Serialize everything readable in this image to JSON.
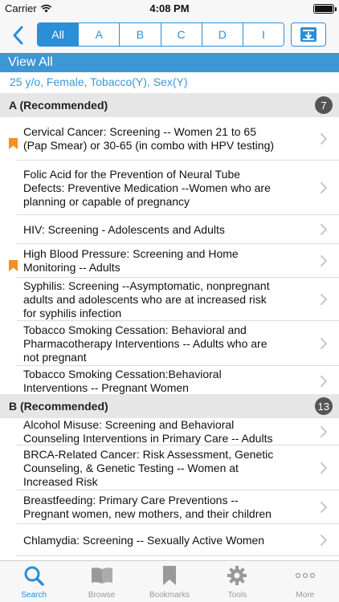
{
  "status_bar": {
    "carrier": "Carrier",
    "time": "4:08 PM"
  },
  "nav": {
    "segments": [
      "All",
      "A",
      "B",
      "C",
      "D",
      "I"
    ],
    "active_segment": "All"
  },
  "view": {
    "title": "View All",
    "criteria": "25 y/o, Female, Tobacco(Y), Sex(Y)"
  },
  "sections": [
    {
      "title": "A (Recommended)",
      "count": "7",
      "items": [
        {
          "lines": [
            "Cervical Cancer: Screening -- Women 21 to 65",
            "(Pap Smear) or 30-65 (in combo with HPV testing)"
          ],
          "bookmarked": true
        },
        {
          "lines": [
            "Folic Acid for the Prevention of Neural Tube",
            "Defects: Preventive Medication --Women who are",
            "planning or capable of pregnancy"
          ],
          "bookmarked": false
        },
        {
          "lines": [
            "HIV: Screening - Adolescents and Adults"
          ],
          "bookmarked": false
        },
        {
          "lines": [
            "High Blood Pressure: Screening and Home",
            "Monitoring -- Adults"
          ],
          "bookmarked": true
        },
        {
          "lines": [
            "Syphilis: Screening --Asymptomatic, nonpregnant",
            "adults and adolescents who are at increased risk",
            "for syphilis infection"
          ],
          "bookmarked": false
        },
        {
          "lines": [
            "Tobacco Smoking Cessation: Behavioral and",
            "Pharmacotherapy Interventions -- Adults who are",
            "not pregnant"
          ],
          "bookmarked": false
        },
        {
          "lines": [
            "Tobacco Smoking Cessation:Behavioral",
            "Interventions -- Pregnant Women"
          ],
          "bookmarked": false
        }
      ]
    },
    {
      "title": "B (Recommended)",
      "count": "13",
      "items": [
        {
          "lines": [
            "Alcohol Misuse: Screening and Behavioral",
            "Counseling Interventions in Primary Care -- Adults"
          ],
          "bookmarked": false
        },
        {
          "lines": [
            "BRCA-Related Cancer: Risk Assessment, Genetic",
            "Counseling, & Genetic Testing -- Women at",
            "Increased Risk"
          ],
          "bookmarked": false
        },
        {
          "lines": [
            "Breastfeeding: Primary Care Preventions --",
            "Pregnant women, new mothers, and their children"
          ],
          "bookmarked": false
        },
        {
          "lines": [
            "Chlamydia: Screening -- Sexually Active Women"
          ],
          "bookmarked": false
        }
      ]
    }
  ],
  "tabs": [
    {
      "label": "Search",
      "icon": "search-icon",
      "active": true
    },
    {
      "label": "Browse",
      "icon": "book-icon",
      "active": false
    },
    {
      "label": "Bookmarks",
      "icon": "bookmark-icon",
      "active": false
    },
    {
      "label": "Tools",
      "icon": "gear-icon",
      "active": false
    },
    {
      "label": "More",
      "icon": "more-icon",
      "active": false
    }
  ],
  "colors": {
    "accent": "#2a8fd6",
    "header_blue": "#3b97d6",
    "bookmark": "#f0902a",
    "section_bg": "#e6e6e6",
    "badge": "#555555"
  }
}
